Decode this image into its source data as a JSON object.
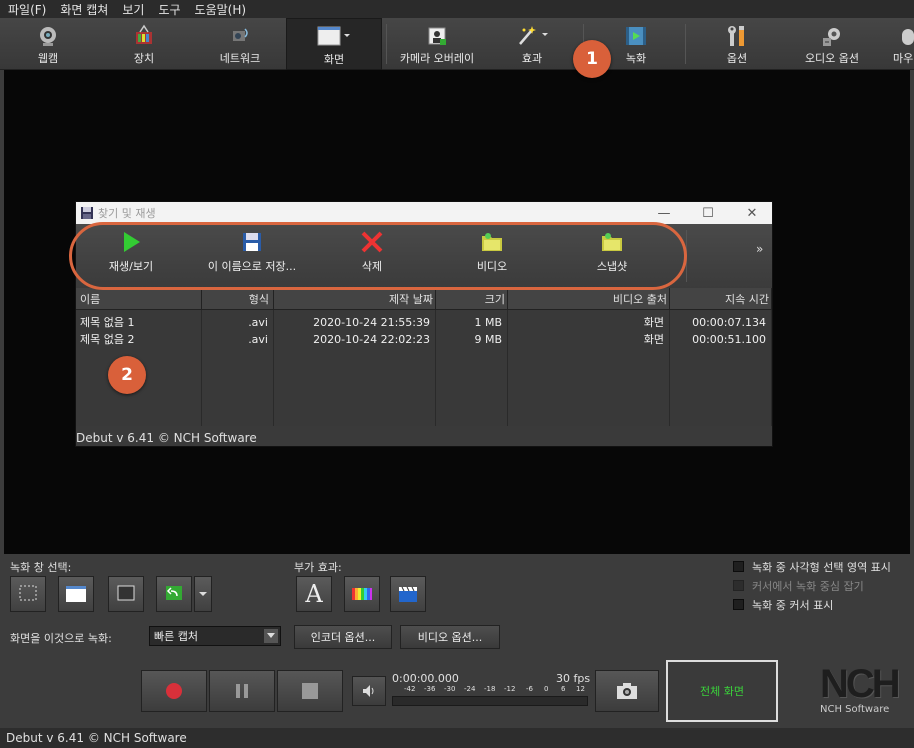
{
  "menu": [
    "파일(F)",
    "화면 캡쳐",
    "보기",
    "도구",
    "도움말(H)"
  ],
  "toolbar": {
    "items": [
      {
        "label": "웹캠",
        "icon": "webcam-icon"
      },
      {
        "label": "장치",
        "icon": "device-icon"
      },
      {
        "label": "네트워크",
        "icon": "network-icon"
      },
      {
        "label": "화면",
        "icon": "screen-icon",
        "active": true
      },
      {
        "label": "카메라 오버레이",
        "icon": "camera-overlay-icon"
      },
      {
        "label": "효과",
        "icon": "effects-wand-icon"
      },
      {
        "label": "녹화",
        "icon": "record-video-icon"
      },
      {
        "label": "옵션",
        "icon": "options-tools-icon"
      },
      {
        "label": "오디오 옵션",
        "icon": "audio-options-icon"
      },
      {
        "label": "마우",
        "icon": "mouse-icon"
      }
    ]
  },
  "callouts": {
    "one": "1",
    "two": "2"
  },
  "window": {
    "title": "찾기 및 재생",
    "tools": [
      {
        "label": "재생/보기",
        "icon": "play-icon"
      },
      {
        "label": "이 이름으로 저장...",
        "icon": "save-as-icon"
      },
      {
        "label": "삭제",
        "icon": "delete-icon"
      },
      {
        "label": "비디오",
        "icon": "video-folder-icon"
      },
      {
        "label": "스냅샷",
        "icon": "snapshot-folder-icon"
      }
    ],
    "more": "»",
    "columns": [
      "이름",
      "형식",
      "제작 날짜",
      "크기",
      "비디오 출처",
      "지속 시간"
    ],
    "rows": [
      [
        "제목 없음 1",
        ".avi",
        "2020-10-24 21:55:39",
        "1 MB",
        "화면",
        "00:00:07.134"
      ],
      [
        "제목 없음 2",
        ".avi",
        "2020-10-24 22:02:23",
        "9 MB",
        "화면",
        "00:00:51.100"
      ]
    ],
    "status": "Debut v 6.41 © NCH Software"
  },
  "bottom": {
    "record_area_label": "녹화 창 선택:",
    "extra_effects_label": "부가 효과:",
    "checkboxes": [
      {
        "label": "녹화 중 사각형 선택 영역 표시",
        "checked": false,
        "enabled": true
      },
      {
        "label": "커서에서 녹화 중심 잡기",
        "checked": false,
        "enabled": false
      },
      {
        "label": "녹화 중 커서 표시",
        "checked": false,
        "enabled": true
      }
    ],
    "record_as_label": "화면을 이것으로 녹화:",
    "record_as_value": "빠른 캡처",
    "encoder_btn": "인코더 옵션...",
    "video_btn": "비디오 옵션...",
    "time": "0:00:00.000",
    "fps": "30 fps",
    "meter_ticks": [
      "-42",
      "-36",
      "-30",
      "-24",
      "-18",
      "-12",
      "-6",
      "0",
      "6",
      "12"
    ],
    "fullscreen": "전체 화면",
    "logo": "NCH",
    "logo_sub": "NCH Software"
  },
  "statusbar": "Debut v 6.41 © NCH Software"
}
